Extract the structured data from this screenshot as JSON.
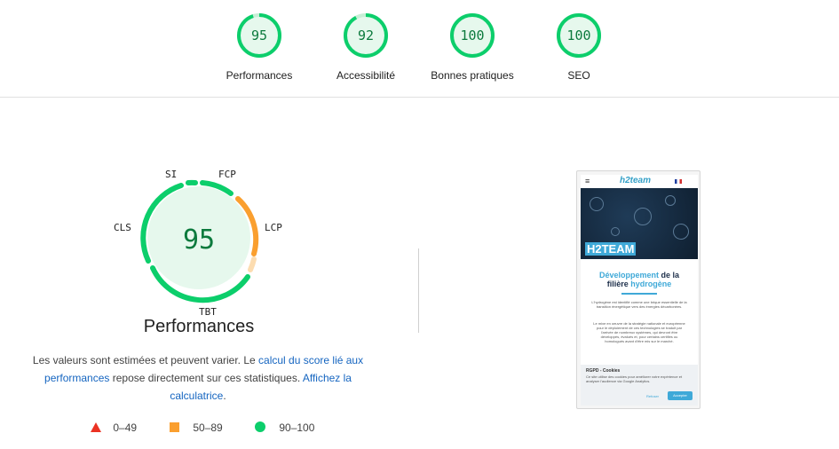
{
  "categories": [
    {
      "label": "Performances",
      "score": "95",
      "value": 95,
      "color": "#0cce6b"
    },
    {
      "label": "Accessibilité",
      "score": "92",
      "value": 92,
      "color": "#0cce6b"
    },
    {
      "label": "Bonnes pratiques",
      "score": "100",
      "value": 100,
      "color": "#0cce6b"
    },
    {
      "label": "SEO",
      "score": "100",
      "value": 100,
      "color": "#0cce6b"
    }
  ],
  "main": {
    "score": "95",
    "title": "Performances",
    "metrics": {
      "si": "SI",
      "fcp": "FCP",
      "lcp": "LCP",
      "tbt": "TBT",
      "cls": "CLS"
    },
    "description": {
      "text1": "Les valeurs sont estimées et peuvent varier. Le ",
      "link1": "calcul du score lié aux performances",
      "text2": " repose directement sur ces statistiques. ",
      "link2": "Affichez la calculatrice",
      "text3": "."
    }
  },
  "legend": [
    {
      "range": "0–49",
      "icon": "triangle-icon",
      "color": "#eb3223"
    },
    {
      "range": "50–89",
      "icon": "square-icon",
      "color": "#fa9f2f"
    },
    {
      "range": "90–100",
      "icon": "circle-icon",
      "color": "#0cce6b"
    }
  ],
  "thumbnail": {
    "logo": "h2team",
    "hero_name": "H2TEAM",
    "title_a": "Développement",
    "title_b": " de la",
    "title_c": "filière ",
    "title_d": "hydrogène",
    "para1": "L'hydrogène est identifié comme une brique essentielle de la transition énergétique vers des énergies décarbonées.",
    "para2": "Le mixe en oeuvre de la stratégie nationale et européenne pour le déploiement de ces technologies se traduit par l'arrivée de nombreux systèmes, qui devront être développés, évalués et, pour certains certifiés ou homologués avant d'être mis sur le marché.",
    "cookie_title": "RGPD - Cookies",
    "cookie_text": "Ce site utilise des cookies pour améliorer votre expérience et analyser l'audience via Google Analytics.",
    "refuse": "Refuser",
    "accept": "Accepter"
  }
}
